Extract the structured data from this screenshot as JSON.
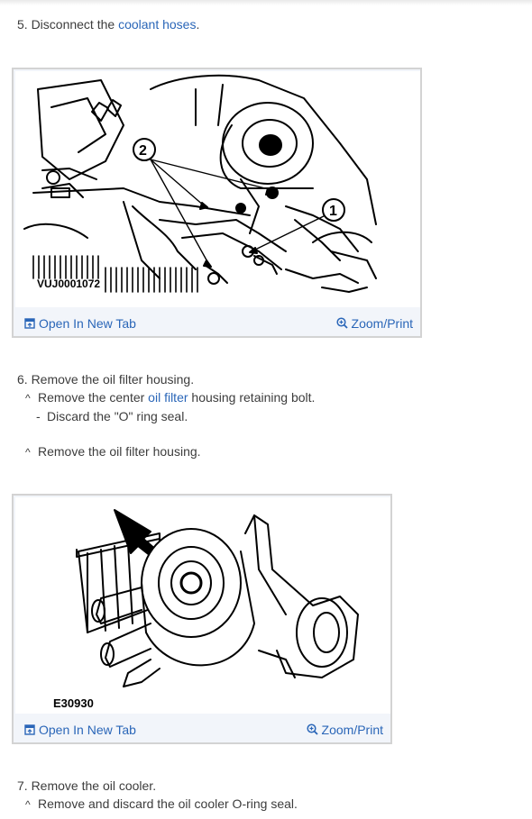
{
  "step5": {
    "prefix": "5. Disconnect the ",
    "link": "coolant hoses",
    "suffix": "."
  },
  "figure1": {
    "code": "VUJ0001072",
    "callout_1": "1",
    "callout_2": "2",
    "open_tab": "Open In New Tab",
    "zoom": "Zoom/Print"
  },
  "step6": {
    "title": "6. Remove the oil filter housing.",
    "sub1": {
      "prefix": "Remove the center ",
      "link": "oil filter",
      "suffix": " housing retaining bolt."
    },
    "sub1a": "Discard the \"O\" ring seal.",
    "sub2": "Remove the oil filter housing."
  },
  "figure2": {
    "code": "E30930",
    "open_tab": "Open In New Tab",
    "zoom": "Zoom/Print"
  },
  "step7": {
    "title": "7. Remove the oil cooler.",
    "sub1": "Remove and discard the oil cooler O-ring seal."
  },
  "icons": {
    "bullet": "^",
    "dash": "-",
    "open_tab": "new-tab-icon",
    "zoom": "zoom-in-icon"
  },
  "colors": {
    "link": "#2a66b8",
    "figure_border": "#d3d3d3",
    "figure_bar": "#f2f5fa"
  }
}
